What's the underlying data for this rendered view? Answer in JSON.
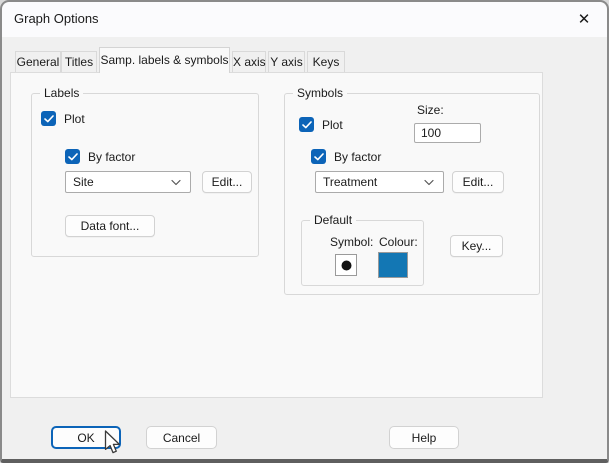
{
  "window": {
    "title": "Graph Options",
    "close_icon": "✕"
  },
  "tabs": [
    {
      "label": "General",
      "active": false
    },
    {
      "label": "Titles",
      "active": false
    },
    {
      "label": "Samp. labels & symbols",
      "active": true
    },
    {
      "label": "X axis",
      "active": false
    },
    {
      "label": "Y axis",
      "active": false
    },
    {
      "label": "Keys",
      "active": false
    }
  ],
  "labels_group": {
    "title": "Labels",
    "plot_checkbox_label": "Plot",
    "plot_checked": true,
    "by_factor_checkbox_label": "By factor",
    "by_factor_checked": true,
    "factor_selected_value": "Site",
    "edit_button_label": "Edit...",
    "data_font_button_label": "Data font..."
  },
  "symbols_group": {
    "title": "Symbols",
    "plot_checkbox_label": "Plot",
    "plot_checked": true,
    "size_label": "Size:",
    "size_value": "100",
    "by_factor_checkbox_label": "By factor",
    "by_factor_checked": true,
    "factor_selected_value": "Treatment",
    "edit_button_label": "Edit...",
    "default_group": {
      "title": "Default",
      "symbol_label": "Symbol:",
      "colour_label": "Colour:",
      "symbol_shape": "filled-circle",
      "colour_value": "#1377b4"
    },
    "key_button_label": "Key..."
  },
  "footer": {
    "ok_label": "OK",
    "cancel_label": "Cancel",
    "help_label": "Help"
  },
  "colors": {
    "accent": "#0c64b8",
    "swatch_blue": "#1377b4",
    "titlebar_bg": "#fbfbfd",
    "dialog_bg": "#f0f0f0",
    "panel_bg": "#f9f9f9"
  }
}
